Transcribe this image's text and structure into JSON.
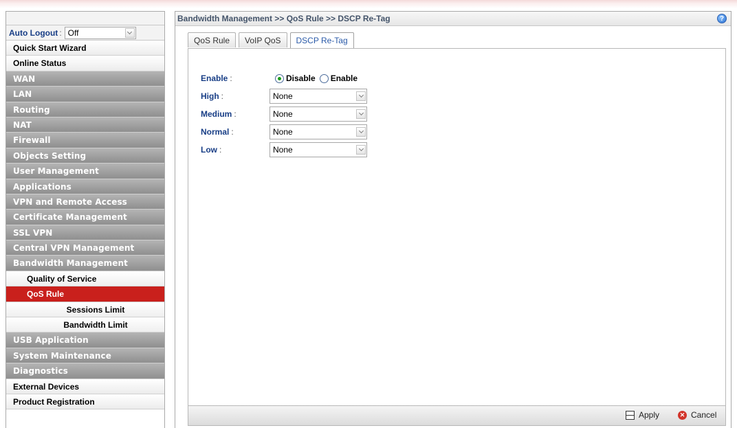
{
  "sidebar": {
    "auto_logout": {
      "label": "Auto Logout",
      "colon": ":",
      "value": "Off"
    },
    "items": [
      {
        "label": "Quick Start Wizard",
        "style": "light"
      },
      {
        "label": "Online Status",
        "style": "light"
      },
      {
        "label": "WAN",
        "style": "dark"
      },
      {
        "label": "LAN",
        "style": "dark"
      },
      {
        "label": "Routing",
        "style": "dark"
      },
      {
        "label": "NAT",
        "style": "dark"
      },
      {
        "label": "Firewall",
        "style": "dark"
      },
      {
        "label": "Objects Setting",
        "style": "dark"
      },
      {
        "label": "User Management",
        "style": "dark"
      },
      {
        "label": "Applications",
        "style": "dark"
      },
      {
        "label": "VPN and Remote Access",
        "style": "dark"
      },
      {
        "label": "Certificate Management",
        "style": "dark"
      },
      {
        "label": "SSL VPN",
        "style": "dark"
      },
      {
        "label": "Central VPN Management",
        "style": "dark"
      },
      {
        "label": "Bandwidth Management",
        "style": "dark"
      },
      {
        "label": "Quality of Service",
        "style": "sub"
      },
      {
        "label": "QoS Rule",
        "style": "active"
      },
      {
        "label": "Sessions Limit",
        "style": "sub-center"
      },
      {
        "label": "Bandwidth Limit",
        "style": "sub-center"
      },
      {
        "label": "USB Application",
        "style": "dark"
      },
      {
        "label": "System Maintenance",
        "style": "dark"
      },
      {
        "label": "Diagnostics",
        "style": "dark"
      },
      {
        "label": "External Devices",
        "style": "light"
      },
      {
        "label": "Product Registration",
        "style": "light"
      }
    ]
  },
  "header": {
    "breadcrumb": "Bandwidth Management >> QoS Rule >> DSCP Re-Tag",
    "help_icon": "question-icon"
  },
  "tabs": [
    {
      "label": "QoS Rule",
      "active": false
    },
    {
      "label": "VoIP QoS",
      "active": false
    },
    {
      "label": "DSCP Re-Tag",
      "active": true
    }
  ],
  "form": {
    "enable": {
      "label": "Enable",
      "options": [
        "Disable",
        "Enable"
      ],
      "selected": "Disable"
    },
    "high": {
      "label": "High",
      "value": "None"
    },
    "medium": {
      "label": "Medium",
      "value": "None"
    },
    "normal": {
      "label": "Normal",
      "value": "None"
    },
    "low": {
      "label": "Low",
      "value": "None"
    },
    "colon": ":"
  },
  "footer": {
    "apply_label": "Apply",
    "cancel_label": "Cancel"
  }
}
